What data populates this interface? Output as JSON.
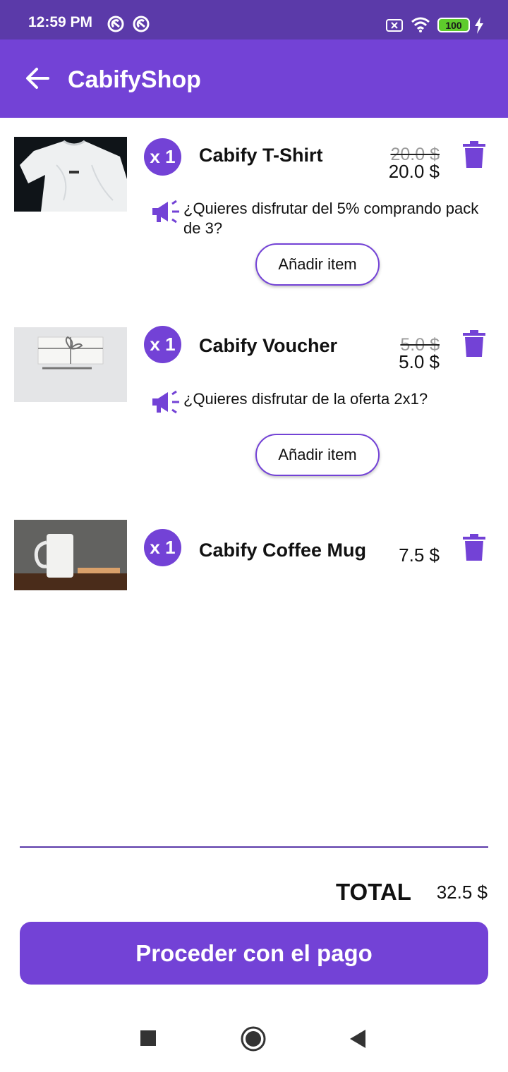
{
  "status_bar": {
    "time": "12:59 PM",
    "battery": "100",
    "icons": [
      "notification-icon",
      "notification-icon",
      "no-sim-icon",
      "wifi-icon",
      "battery-icon",
      "charging-icon"
    ]
  },
  "app_bar": {
    "title": "CabifyShop",
    "back_icon": "arrow-back-icon"
  },
  "cart": {
    "items": [
      {
        "quantity": "x 1",
        "name": "Cabify T-Shirt",
        "original_price": "20.0 $",
        "price": "20.0 $",
        "image": "white-tshirt-photo",
        "promo": "¿Quieres disfrutar del 5% comprando pack de 3?",
        "add_button": "Añadir item"
      },
      {
        "quantity": "x 1",
        "name": "Cabify Voucher",
        "original_price": "5.0 $",
        "price": "5.0 $",
        "image": "gift-voucher-photo",
        "promo": "¿Quieres disfrutar de la oferta 2x1?",
        "add_button": "Añadir item"
      },
      {
        "quantity": "x 1",
        "name": "Cabify Coffee Mug",
        "price": "7.5 $",
        "image": "coffee-mug-photo"
      }
    ]
  },
  "footer": {
    "total_label": "TOTAL",
    "total_value": "32.5 $",
    "pay_button": "Proceder con el pago"
  },
  "colors": {
    "primary": "#7342d6",
    "status_bar": "#5b3aa9"
  }
}
